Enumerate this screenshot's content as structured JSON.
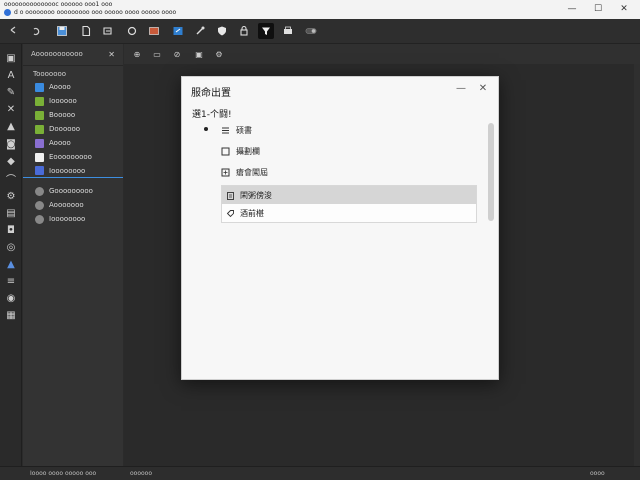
{
  "titlebar": {
    "line1": "ooooooooooooooc oooooo ooo1   ooo",
    "line2": "d   o   oooooooo   ooooooooo   ooo   ooooo   oooo   ooooo   oooo"
  },
  "window_controls": {
    "minimize": "—",
    "maximize": "☐",
    "close": "✕"
  },
  "sidebar": {
    "header": "Aooooooooooo",
    "header_close": "✕",
    "group_label": "Tooooooo",
    "items": [
      {
        "label": "Aoooo",
        "color": "#3a8be0"
      },
      {
        "label": "Ioooooo",
        "color": "#7ab037"
      },
      {
        "label": "Booooo",
        "color": "#7ab037"
      },
      {
        "label": "Doooooo",
        "color": "#7ab037"
      },
      {
        "label": "Aoooo",
        "color": "#8a6fd1"
      },
      {
        "label": "Eooooooooo",
        "color": "#f0f0f0"
      },
      {
        "label": "Ioooooooo",
        "color": "#4a6bd8"
      }
    ],
    "sub_items": [
      {
        "label": "Gooooooooo"
      },
      {
        "label": "Aooooooo"
      },
      {
        "label": "Ioooooooo"
      }
    ]
  },
  "statusbar": {
    "left": "Ioooo oooo ooooo ooo",
    "mid": "oooooo",
    "right": "oooo"
  },
  "dialog": {
    "title": "服命出置",
    "prompt": "選1-个闘!",
    "options": [
      {
        "label": "硕書",
        "icon": "stack-icon"
      },
      {
        "label": "攝劃欄",
        "icon": "square-icon"
      },
      {
        "label": "瘡會闖屆",
        "icon": "plus-box-icon"
      }
    ],
    "list": [
      {
        "label": "閑粥傍浚",
        "icon": "clipboard-icon",
        "highlighted": true
      },
      {
        "label": "酒前椹",
        "icon": "tag-icon",
        "highlighted": false
      }
    ],
    "minimize": "—",
    "close": "✕"
  },
  "colors": {
    "accent": "#3d8ee0",
    "dialog_highlight": "#d6d6d6"
  }
}
